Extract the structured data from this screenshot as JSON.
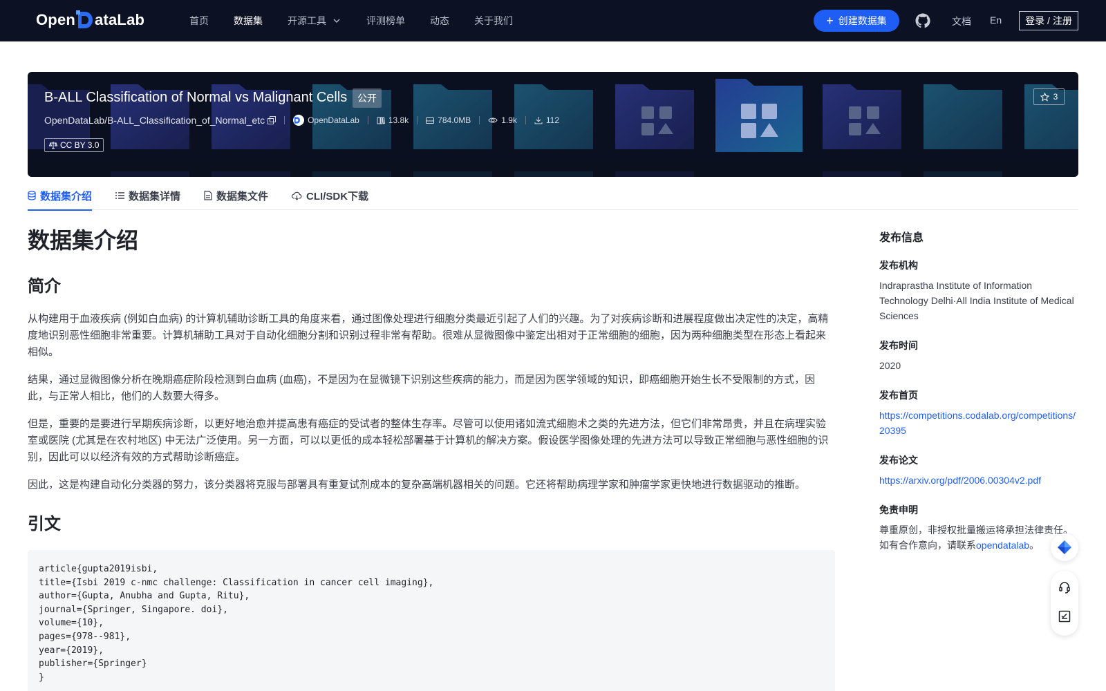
{
  "nav": {
    "logo_left": "Open",
    "logo_right": "ataLab",
    "items": [
      "首页",
      "数据集",
      "开源工具",
      "评测榜单",
      "动态",
      "关于我们"
    ],
    "active_index": 1,
    "create_label": "创建数据集",
    "docs_label": "文档",
    "lang_label": "En",
    "login_label": "登录 / 注册"
  },
  "banner": {
    "title": "B-ALL Classification of Normal vs Malignant Cells",
    "visibility": "公开",
    "path": "OpenDataLab/B-ALL_Classification_of_Normal_etc",
    "org": "OpenDataLab",
    "views_count": "13.8k",
    "size": "784.0MB",
    "visits": "1.9k",
    "downloads": "112",
    "license": "CC BY 3.0",
    "stars": "3"
  },
  "tabs": [
    "数据集介绍",
    "数据集详情",
    "数据集文件",
    "CLI/SDK下载"
  ],
  "content": {
    "heading": "数据集介绍",
    "intro_heading": "简介",
    "paragraphs": [
      "从构建用于血液疾病 (例如白血病) 的计算机辅助诊断工具的角度来看，通过图像处理进行细胞分类最近引起了人们的兴趣。为了对疾病诊断和进展程度做出决定性的决定，高精度地识别恶性细胞非常重要。计算机辅助工具对于自动化细胞分割和识别过程非常有帮助。很难从显微图像中鉴定出相对于正常细胞的细胞，因为两种细胞类型在形态上看起来相似。",
      "结果，通过显微图像分析在晚期癌症阶段检测到白血病 (血癌)，不是因为在显微镜下识别这些疾病的能力，而是因为医学领域的知识，即癌细胞开始生长不受限制的方式，因此，与正常人相比，他们的人数要大得多。",
      "但是，重要的是要进行早期疾病诊断，以更好地治愈并提高患有癌症的受试者的整体生存率。尽管可以使用诸如流式细胞术之类的先进方法，但它们非常昂贵，并且在病理实验室或医院 (尤其是在农村地区) 中无法广泛使用。另一方面，可以以更低的成本轻松部署基于计算机的解决方案。假设医学图像处理的先进方法可以导致正常细胞与恶性细胞的识别，因此可以以经济有效的方式帮助诊断癌症。",
      "因此，这是构建自动化分类器的努力，该分类器将克服与部署具有重复试剂成本的复杂高端机器相关的问题。它还将帮助病理学家和肿瘤学家更快地进行数据驱动的推断。"
    ],
    "citation_heading": "引文",
    "citation": "article{gupta2019isbi,\ntitle={Isbi 2019 c-nmc challenge: Classification in cancer cell imaging},\nauthor={Gupta, Anubha and Gupta, Ritu},\njournal={Springer, Singapore. doi},\nvolume={10},\npages={978--981},\nyear={2019},\npublisher={Springer}\n}"
  },
  "sidebar": {
    "title": "发布信息",
    "org_label": "发布机构",
    "org_value": "Indraprastha Institute of Information Technology Delhi·All India Institute of Medical Sciences",
    "time_label": "发布时间",
    "time_value": "2020",
    "home_label": "发布首页",
    "home_url": "https://competitions.codalab.org/competitions/20395",
    "paper_label": "发布论文",
    "paper_url": "https://arxiv.org/pdf/2006.00304v2.pdf",
    "disclaimer_label": "免责申明",
    "disclaimer_line1": "尊重原创，非授权批量搬运将承担法律责任。",
    "disclaimer_line2_prefix": "如有合作意向，请联系",
    "disclaimer_contact": "opendatalab",
    "disclaimer_line2_suffix": "。"
  },
  "colors": {
    "nav_bg": "#0c1223",
    "accent": "#1f5ef5",
    "banner_bg": "#0b1020"
  }
}
